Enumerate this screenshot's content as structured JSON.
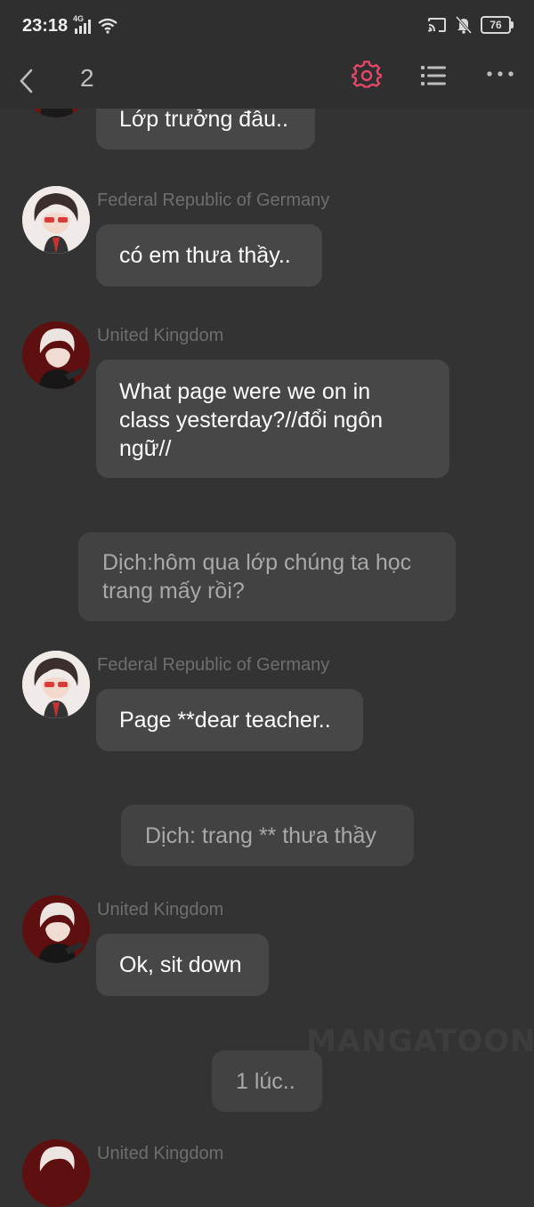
{
  "status": {
    "time": "23:18",
    "network": "4G",
    "battery": "76"
  },
  "header": {
    "chapter": "2"
  },
  "icons": {
    "back": "chevron-left-icon",
    "settings": "gear-icon",
    "list": "list-icon",
    "more": "more-horizontal-icon",
    "accent_color": "#e8466a"
  },
  "messages": [
    {
      "type": "chat",
      "sender": "",
      "text": "Lớp trưởng đâu.."
    },
    {
      "type": "chat",
      "sender": "Federal Republic of Germany",
      "text": "có em thưa thầy.."
    },
    {
      "type": "chat",
      "sender": "United Kingdom",
      "text": "What page were we on in class yesterday?//đổi ngôn ngữ//"
    },
    {
      "type": "narration",
      "text": "Dịch:hôm qua lớp chúng ta học trang mấy rồi?"
    },
    {
      "type": "chat",
      "sender": "Federal Republic of Germany",
      "text": "Page **dear teacher.."
    },
    {
      "type": "narration",
      "text": "Dịch: trang ** thưa thầy"
    },
    {
      "type": "chat",
      "sender": "United Kingdom",
      "text": "Ok, sit down"
    },
    {
      "type": "narration",
      "text": "1 lúc.."
    },
    {
      "type": "chat",
      "sender": "United Kingdom",
      "text": ""
    }
  ],
  "watermark": "MANGATOON"
}
